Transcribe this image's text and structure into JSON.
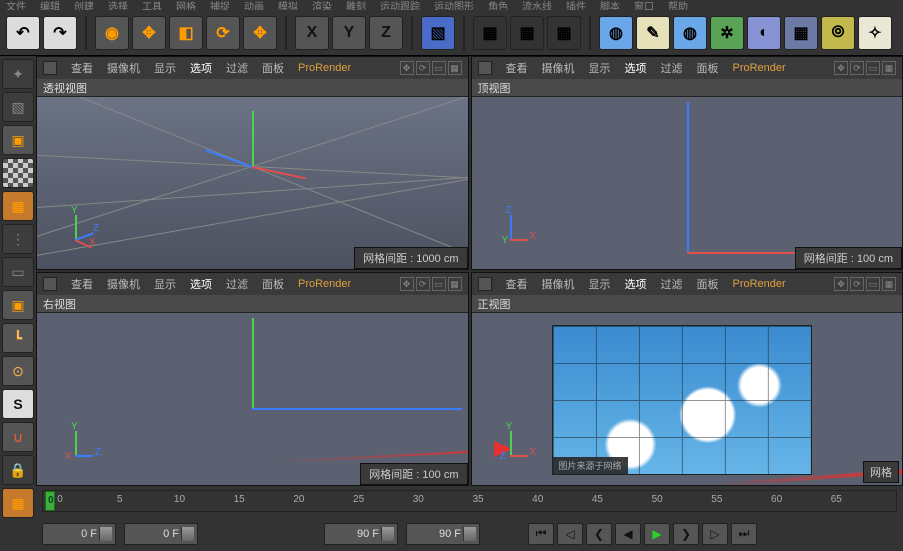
{
  "menu": [
    "文件",
    "编辑",
    "创建",
    "选择",
    "工具",
    "网格",
    "捕捉",
    "动画",
    "模拟",
    "渲染",
    "雕刻",
    "运动跟踪",
    "运动图形",
    "角色",
    "流水线",
    "插件",
    "脚本",
    "窗口",
    "帮助"
  ],
  "viewport_menu": {
    "items": [
      "查看",
      "摄像机",
      "显示",
      "选项",
      "过滤",
      "面板"
    ],
    "prorender": "ProRender",
    "active_index": 3
  },
  "viewports": {
    "persp": {
      "title": "透视视图",
      "footer": "网格间距 : 1000 cm"
    },
    "top": {
      "title": "顶视图",
      "footer": "网格间距 : 100 cm"
    },
    "right": {
      "title": "右视图",
      "footer": "网格间距 : 100 cm"
    },
    "front": {
      "title": "正视图",
      "footer_partial": "网格"
    }
  },
  "axes": {
    "x": "X",
    "y": "Y",
    "z": "Z"
  },
  "timeline": {
    "ticks": [
      0,
      5,
      10,
      15,
      20,
      25,
      30,
      35,
      40,
      45,
      50,
      55,
      60,
      65
    ],
    "ticks2": [
      10,
      15,
      20,
      25,
      30,
      35
    ],
    "frame_start": "0 F",
    "frame_a": "0 F",
    "frame_b": "90 F",
    "frame_end": "90 F",
    "zero_label": "0"
  },
  "icons": {
    "undo": "↶",
    "redo": "↷",
    "select": "▢",
    "move": "✥",
    "rotate": "⟳",
    "scale": "⤢",
    "axis_x": "X",
    "axis_y": "Y",
    "axis_z": "Z",
    "first": "⏮",
    "prev": "◀",
    "keyprev": "◁",
    "play": "▶",
    "keynext": "▷",
    "next": "▶",
    "last": "⏭",
    "rec": "●"
  },
  "sky_caption": "图片来源于网络"
}
